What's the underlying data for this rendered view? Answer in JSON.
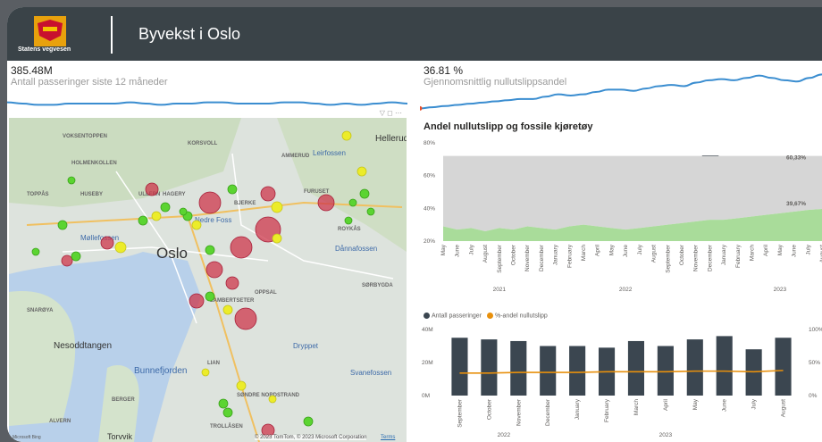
{
  "header": {
    "logo_text": "Statens vegvesen",
    "title": "Byvekst i Oslo"
  },
  "kpi_passages": {
    "value": "385.48M",
    "label": "Antall passeringer siste 12 måneder"
  },
  "kpi_zero_emission": {
    "value": "36.81 %",
    "label": "Gjennomsnittlig nullutslippsandel"
  },
  "map": {
    "place_labels": [
      "VOKSENTOPPEN",
      "HOLMENKOLLEN",
      "KORSVOLL",
      "AMMERUD",
      "Hellerud",
      "TOPPÅS",
      "HUSEBY",
      "ULLERN",
      "HAGERY",
      "BJERKE",
      "FURUSET",
      "ROYKÅS",
      "Leirfossen",
      "Møllefossen",
      "Nedre Foss",
      "Oslo",
      "Dånnafossen",
      "SØRBYGDA",
      "OPPSAL",
      "SNARØYA",
      "LAMBERTSETER",
      "Nesoddtangen",
      "Bunnefjorden",
      "Dryppet",
      "Svanefossen",
      "LIAN",
      "BERGER",
      "SØNDRE NORDSTRAND",
      "ALVERN",
      "TROLLÅSEN",
      "Torvvik"
    ],
    "attribution": "© 2023 TomTom, © 2023 Microsoft Corporation",
    "terms": "Terms",
    "bing": "Microsoft Bing"
  },
  "area_chart": {
    "title": "Andel nullutslipp og fossile kjøretøy",
    "fossil_label": "60,33%",
    "zero_label": "39,67%",
    "colors": {
      "fossil": "#d6d6d6",
      "zero": "#a9dc9a"
    }
  },
  "bar_chart": {
    "legend_passages": "Antall passeringer",
    "legend_share": "%-andel nullutslipp",
    "colors": {
      "bars": "#3b4650",
      "line": "#e8900c"
    }
  },
  "chart_data": [
    {
      "type": "area",
      "title": "Andel nullutslipp og fossile kjøretøy",
      "categories": [
        "May",
        "June",
        "July",
        "August",
        "September",
        "October",
        "November",
        "December",
        "January",
        "February",
        "March",
        "April",
        "May",
        "June",
        "July",
        "August",
        "September",
        "October",
        "November",
        "December",
        "January",
        "February",
        "March",
        "April",
        "May",
        "June",
        "July",
        "August"
      ],
      "years": [
        "2021",
        "2022",
        "2023"
      ],
      "yticks": [
        "80%",
        "60%",
        "40%",
        "20%"
      ],
      "ylim": [
        20,
        80
      ],
      "series": [
        {
          "values": [
            71,
            73,
            72,
            74,
            72,
            73,
            71,
            72,
            73,
            71,
            70,
            71,
            72,
            73,
            72,
            71,
            70,
            69,
            68,
            67,
            67,
            66,
            65,
            64,
            63,
            62,
            61,
            60.33
          ]
        },
        {
          "values": [
            29,
            27,
            28,
            26,
            28,
            27,
            29,
            28,
            27,
            29,
            30,
            29,
            28,
            27,
            28,
            29,
            30,
            31,
            32,
            33,
            33,
            34,
            35,
            36,
            37,
            38,
            39,
            39.67
          ]
        }
      ],
      "end_labels": [
        "60,33%",
        "39,67%"
      ]
    },
    {
      "type": "bar",
      "categories": [
        "September",
        "October",
        "November",
        "December",
        "January",
        "February",
        "March",
        "April",
        "May",
        "June",
        "July",
        "August"
      ],
      "years": [
        "2022",
        "2023"
      ],
      "series": [
        {
          "name": "Antall passeringer",
          "values": [
            35,
            34,
            33,
            30,
            30,
            29,
            33,
            30,
            34,
            36,
            28,
            35
          ]
        },
        {
          "name": "%-andel nullutslipp",
          "values": [
            34,
            34,
            35,
            35,
            35,
            36,
            36,
            36,
            37,
            37,
            36,
            38
          ]
        }
      ],
      "yticks_left": [
        "40M",
        "20M",
        "0M"
      ],
      "yticks_right": [
        "100%",
        "50%",
        "0%"
      ],
      "ylim_left": [
        0,
        40
      ],
      "ylim_right": [
        0,
        100
      ]
    },
    {
      "type": "line",
      "title": "Antall passeringer siste 12 måneder",
      "values": [
        28,
        27,
        26,
        26,
        27,
        27,
        27,
        27,
        28,
        27,
        26,
        27,
        27,
        28,
        28,
        27,
        27,
        27,
        28,
        28,
        27,
        26,
        27,
        26,
        27,
        28,
        27
      ]
    },
    {
      "type": "line",
      "title": "Gjennomsnittlig nullutslippsandel",
      "values": [
        12,
        13,
        14,
        15,
        16,
        17,
        18,
        19,
        20,
        20,
        22,
        24,
        23,
        24,
        26,
        28,
        28,
        27,
        29,
        31,
        32,
        31,
        34,
        36,
        37,
        36,
        38,
        40,
        38,
        36,
        35,
        38,
        41
      ]
    }
  ]
}
